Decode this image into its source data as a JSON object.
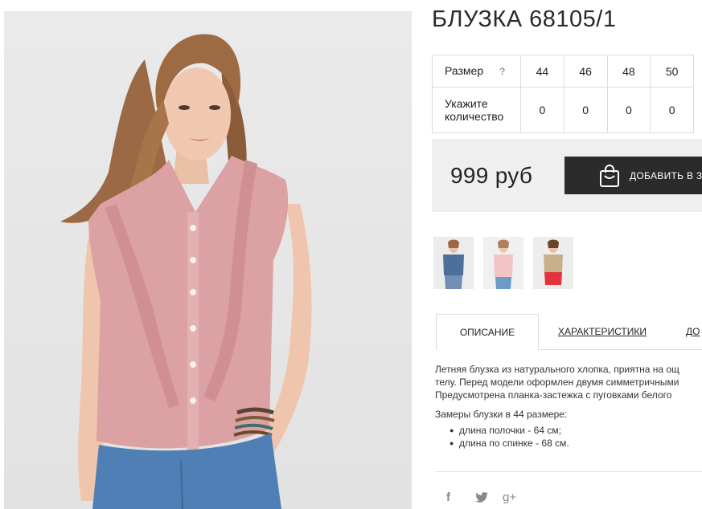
{
  "product": {
    "title": "БЛУЗКА 68105/1",
    "image_alt": "product-photo"
  },
  "sizes": {
    "size_label": "Размер",
    "help_icon": "?",
    "qty_label_line1": "Укажите",
    "qty_label_line2": "количество",
    "columns": [
      "44",
      "46",
      "48",
      "50"
    ],
    "quantities": [
      "0",
      "0",
      "0",
      "0"
    ]
  },
  "purchase": {
    "price": "999 руб",
    "add_button_label": "ДОБАВИТЬ В З",
    "add_button_icon": "shopping-bag-icon"
  },
  "tabs": {
    "description": "ОПИСАНИЕ",
    "characteristics": "ХАРАКТЕРИСТИКИ",
    "third": "ДО"
  },
  "description": {
    "line1": "Летняя блузка из натурального хлопка, приятна на ощ",
    "line2": "телу. Перед модели оформлен двумя симметричными",
    "line3": "Предусмотрена планка-застежка с пуговками белого",
    "measure_heading": "Замеры блузки в 44 размере:",
    "bullets": [
      "длина полочки - 64 см;",
      "длина по спинке - 68 см."
    ]
  },
  "social": {
    "facebook": "f",
    "twitter": "twitter-icon",
    "googleplus": "g+"
  },
  "colors": {
    "button_bg": "#2b2b2b",
    "price_bg": "#efefef",
    "blouse_pink": "#dca1a3",
    "jeans_blue": "#4f7fb4"
  }
}
